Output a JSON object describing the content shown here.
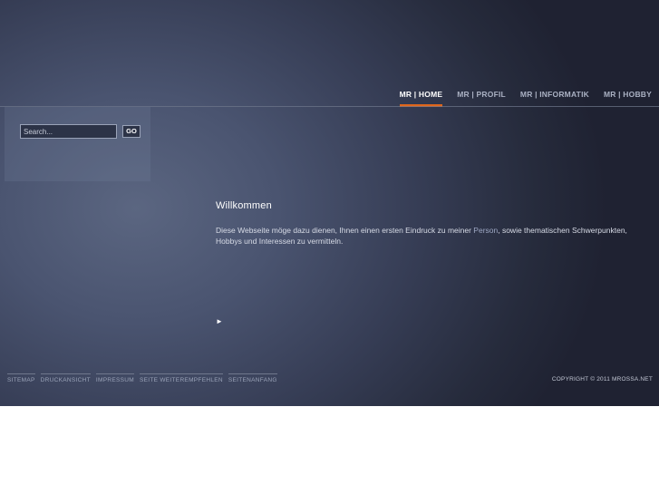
{
  "nav": {
    "items": [
      {
        "label": "MR | HOME",
        "active": true
      },
      {
        "label": "MR | PROFIL",
        "active": false
      },
      {
        "label": "MR | INFORMATIK",
        "active": false
      },
      {
        "label": "MR | HOBBY",
        "active": false
      }
    ],
    "accent_color": "#e0661c"
  },
  "search": {
    "placeholder": "Search...",
    "button_label": "GO"
  },
  "main": {
    "title": "Willkommen",
    "intro_before": "Diese Webseite möge dazu dienen, Ihnen einen ersten Eindruck zu meiner ",
    "intro_link": "Person",
    "intro_after": ", sowie thematischen Schwerpunkten, Hobbys und Interessen zu vermitteln.",
    "arrow": "►"
  },
  "footer": {
    "links": [
      "SITEMAP",
      "DRUCKANSICHT",
      "IMPRESSUM",
      "SEITE WEITEREMPFEHLEN",
      "SEITENANFANG"
    ],
    "copyright": "COPYRIGHT © 2011 MROSSA.NET"
  }
}
